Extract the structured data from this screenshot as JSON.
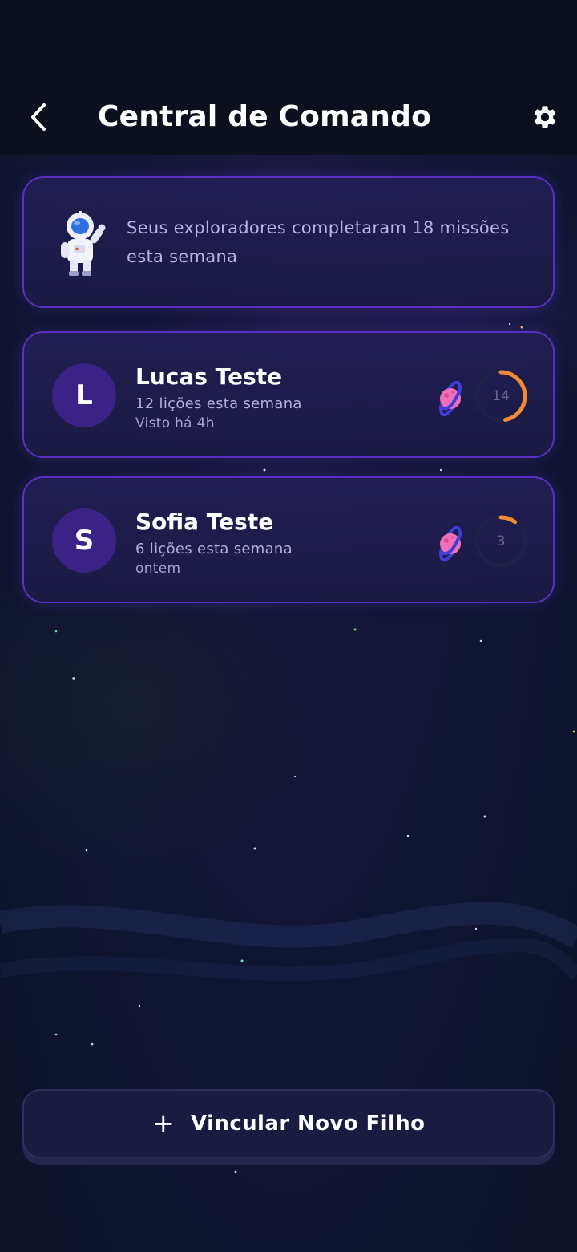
{
  "header": {
    "title": "Central de Comando"
  },
  "summary": {
    "text": "Seus exploradores completaram 18 missões esta semana"
  },
  "children": [
    {
      "initial": "L",
      "name": "Lucas Teste",
      "lessons": "12 lições esta semana",
      "last_seen": "Visto há 4h",
      "ring_value": "14",
      "ring_progress": 0.47
    },
    {
      "initial": "S",
      "name": "Sofia Teste",
      "lessons": "6 lições esta semana",
      "last_seen": "ontem",
      "ring_value": "3",
      "ring_progress": 0.1
    }
  ],
  "add_child": {
    "plus_icon": "+",
    "label": "Vincular Novo Filho"
  },
  "colors": {
    "accent_border": "#5a2fc4",
    "ring_orange": "#f08a35",
    "avatar_bg": "#3b2287"
  }
}
